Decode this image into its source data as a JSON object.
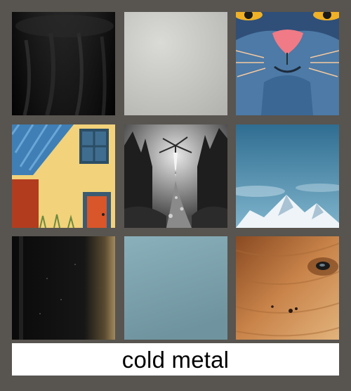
{
  "caption": {
    "text": "cold metal"
  },
  "tiles": [
    {
      "subject": "black-fabric-texture"
    },
    {
      "subject": "light-grey-texture"
    },
    {
      "subject": "cat-face-illustration"
    },
    {
      "subject": "painted-cottage"
    },
    {
      "subject": "dark-forest-stream"
    },
    {
      "subject": "blue-sky-mountain"
    },
    {
      "subject": "black-metal-surface"
    },
    {
      "subject": "slate-blue-texture"
    },
    {
      "subject": "wood-grain-knot"
    }
  ],
  "colors": {
    "background": "#58544f",
    "caption_bar": "#ffffff",
    "caption_text": "#000000"
  }
}
